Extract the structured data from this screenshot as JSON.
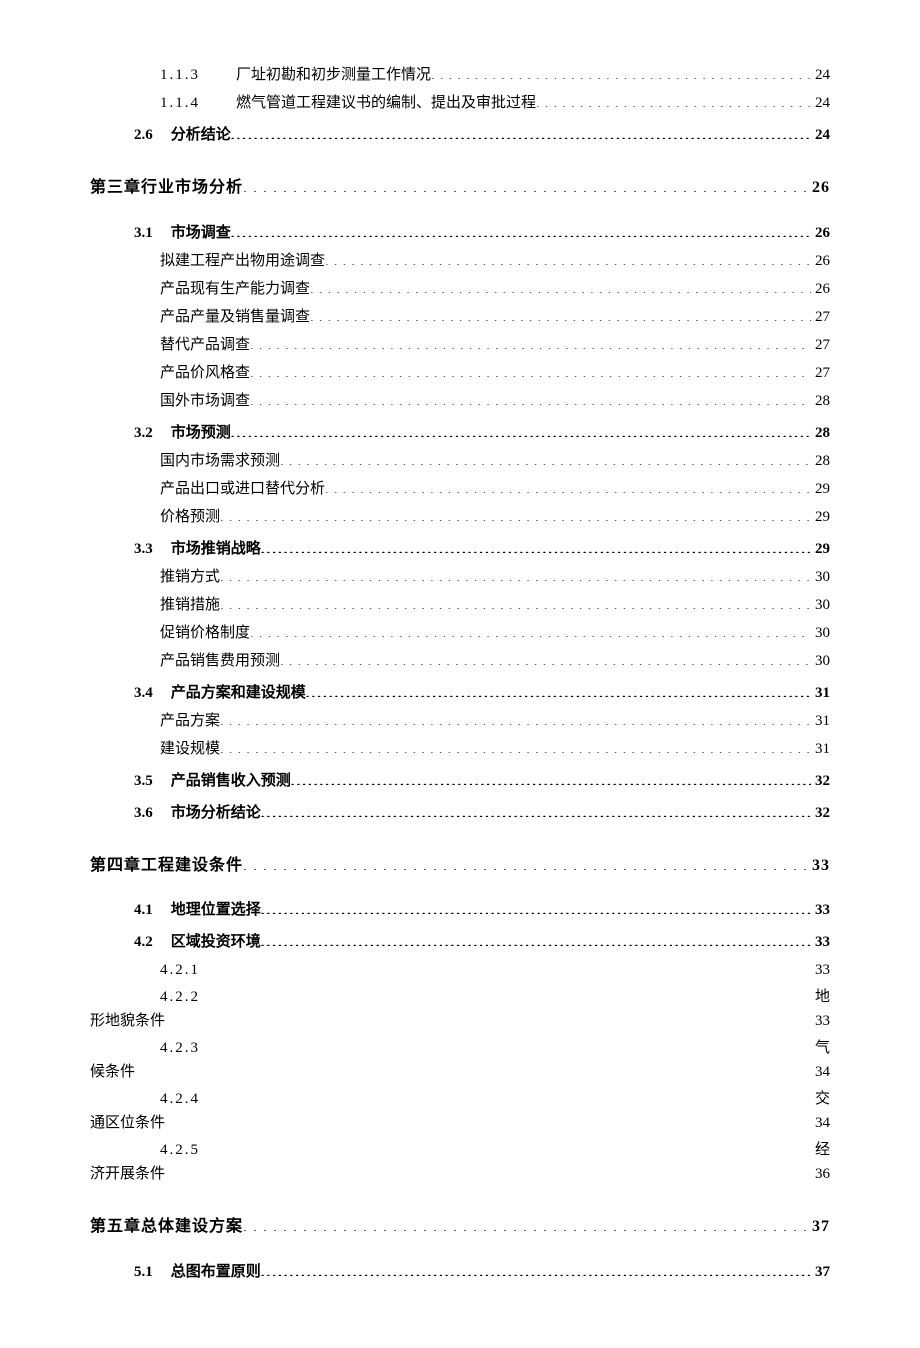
{
  "toc": {
    "pre": [
      {
        "type": "l3b",
        "num": "1.1.3",
        "label": "厂址初勘和初步测量工作情况",
        "page": "24"
      },
      {
        "type": "l3b",
        "num": "1.1.4",
        "label": "燃气管道工程建议书的编制、提出及审批过程",
        "page": "24"
      },
      {
        "type": "l2",
        "num": "2.6",
        "label": "分析结论",
        "page": "24"
      }
    ],
    "ch3": {
      "heading": {
        "label": "第三章行业市场分析",
        "page": "26"
      },
      "items": [
        {
          "type": "l2",
          "num": "3.1",
          "label": "市场调查",
          "page": "26"
        },
        {
          "type": "l3",
          "label": "拟建工程产出物用途调查",
          "page": "26"
        },
        {
          "type": "l3",
          "label": "产品现有生产能力调查",
          "page": "26"
        },
        {
          "type": "l3",
          "label": "产品产量及销售量调查",
          "page": "27"
        },
        {
          "type": "l3",
          "label": "替代产品调查",
          "page": "27"
        },
        {
          "type": "l3",
          "label": "产品价风格查",
          "page": "27"
        },
        {
          "type": "l3",
          "label": "国外市场调查",
          "page": "28"
        },
        {
          "type": "l2",
          "num": "3.2",
          "label": "市场预测",
          "page": "28"
        },
        {
          "type": "l3",
          "label": "国内市场需求预测",
          "page": "28"
        },
        {
          "type": "l3",
          "label": "产品出口或进口替代分析",
          "page": "29"
        },
        {
          "type": "l3",
          "label": "价格预测",
          "page": "29"
        },
        {
          "type": "l2",
          "num": "3.3",
          "label": "市场推销战略",
          "page": "29"
        },
        {
          "type": "l3",
          "label": "推销方式",
          "page": "30"
        },
        {
          "type": "l3",
          "label": "推销措施",
          "page": "30"
        },
        {
          "type": "l3",
          "label": "促销价格制度",
          "page": "30"
        },
        {
          "type": "l3",
          "label": "产品销售费用预测",
          "page": "30"
        },
        {
          "type": "l2",
          "num": "3.4",
          "label": "产品方案和建设规模",
          "page": "31"
        },
        {
          "type": "l3",
          "label": "产品方案",
          "page": "31"
        },
        {
          "type": "l3",
          "label": "建设规模",
          "page": "31"
        },
        {
          "type": "l2",
          "num": "3.5",
          "label": "产品销售收入预测",
          "page": "32"
        },
        {
          "type": "l2",
          "num": "3.6",
          "label": "市场分析结论",
          "page": "32"
        }
      ]
    },
    "ch4": {
      "heading": {
        "label": "第四章工程建设条件",
        "page": "33"
      },
      "items": [
        {
          "type": "l2",
          "num": "4.1",
          "label": "地理位置选择",
          "page": "33"
        },
        {
          "type": "l2",
          "num": "4.2",
          "label": "区域投资环境",
          "page": "33"
        },
        {
          "type": "wrap",
          "num": "4.2.1",
          "right": "33",
          "text": "",
          "page": ""
        },
        {
          "type": "wrap",
          "num": "4.2.2",
          "right": "地",
          "text": "形地貌条件",
          "page": "33"
        },
        {
          "type": "wrap",
          "num": "4.2.3",
          "right": "气",
          "text": "候条件",
          "page": "34"
        },
        {
          "type": "wrap",
          "num": "4.2.4",
          "right": "交",
          "text": "通区位条件",
          "page": "34"
        },
        {
          "type": "wrap",
          "num": "4.2.5",
          "right": "经",
          "text": "济开展条件",
          "page": "36"
        }
      ]
    },
    "ch5": {
      "heading": {
        "label": "第五章总体建设方案",
        "page": "37"
      },
      "items": [
        {
          "type": "l2",
          "num": "5.1",
          "label": "总图布置原则",
          "page": "37"
        }
      ]
    }
  }
}
